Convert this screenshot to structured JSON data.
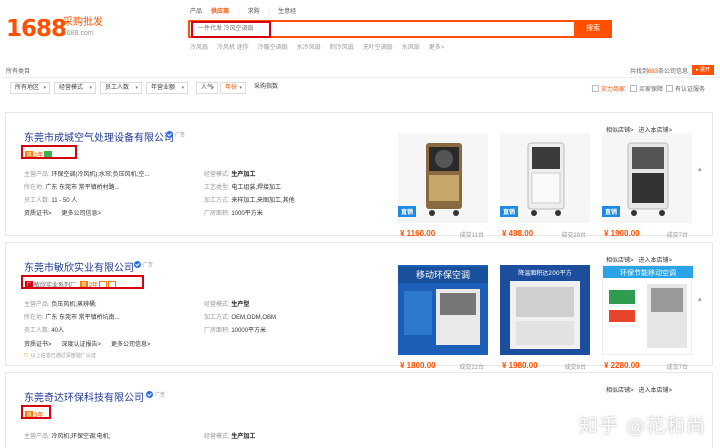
{
  "header": {
    "logo": "1688",
    "logo_sub": "采购批发",
    "logo_url": "1688.com",
    "tabs": [
      "产品",
      "供应商",
      "求购",
      "生意经"
    ],
    "active_tab": 1,
    "search_placeholder": "一件代发 冷风空调扇",
    "search_button": "搜索",
    "hot_words": [
      "冷风扇",
      "冷风机 迷你",
      "冷暖空调扇",
      "水冷风扇",
      "制冷风扇",
      "无叶空调扇",
      "水风扇",
      "更多>"
    ]
  },
  "crumb": {
    "left": "所有类目",
    "right_prefix": "共找到",
    "right_count": "693",
    "right_suffix": "条公司信息",
    "expand": "▸ 展开"
  },
  "filters": {
    "selects": [
      "所有地区",
      "经营模式",
      "员工人数",
      "年营业额"
    ],
    "sort_people": "人气",
    "sort_years": "年份",
    "purchase": "采购指数",
    "checks": [
      "实力商家",
      "买家保障",
      "有认证服务"
    ]
  },
  "cards": [
    {
      "name": "东莞市成城空气处理设备有限公司",
      "ad": "广告",
      "years": "2年",
      "main_products": "环保空调(冷风机);水帘;负压风机;空...",
      "location": "广东 东莞市 常平镇桥村路...",
      "staff": "11 - 50 人",
      "mode": "生产加工",
      "craft": "电工组装,焊接加工",
      "process": "来样加工,来图加工,其他",
      "area": "1000平方米",
      "links": [
        "资质证书>",
        "更多公司信息>"
      ],
      "top_links": [
        "相似店铺>",
        "进入本店铺>"
      ],
      "products": [
        {
          "price": "¥ 1160.00",
          "sold": "成交11台",
          "tag": "直销"
        },
        {
          "price": "¥ 498.00",
          "sold": "成交29台",
          "tag": "直销"
        },
        {
          "price": "¥ 1900.00",
          "sold": "成交7台",
          "tag": "直销"
        }
      ]
    },
    {
      "name": "东莞市敏欣实业有限公司",
      "ad": "广告",
      "badge_text": "敏欣实业系列厂",
      "years": "2年",
      "main_products": "负压风机;蒸辨桶;",
      "location": "广东 东莞市 常平镇桥坑南...",
      "staff": "40人",
      "mode": "生产型",
      "craft": "OEM,ODM,OBM",
      "area": "10000平方米",
      "links": [
        "资质证书>",
        "深度认证报告>",
        "更多公司信息>"
      ],
      "cert": "以上信息已通过深度验厂认证",
      "top_links": [
        "相似店铺>",
        "进入本店铺>"
      ],
      "products": [
        {
          "price": "¥ 1800.00",
          "sold": "成交22台",
          "banner": "移动环保空调"
        },
        {
          "price": "¥ 1980.00",
          "sold": "成交8台",
          "banner": "降温面积达200平方"
        },
        {
          "price": "¥ 2280.00",
          "sold": "成交7台",
          "banner": "环保节能移动空调"
        }
      ]
    },
    {
      "name": "东莞奇达环保科技有限公司",
      "ad": "广告",
      "years": "3年",
      "main_products": "冷风机;环保空调;电机;",
      "mode": "生产加工",
      "top_links": [
        "相似店铺>",
        "进入本店铺>"
      ]
    }
  ],
  "watermark": "知乎 @花和尚",
  "colors": {
    "accent": "#ff5000",
    "company_link": "#1f3a93",
    "red_box": "#d6000f"
  }
}
